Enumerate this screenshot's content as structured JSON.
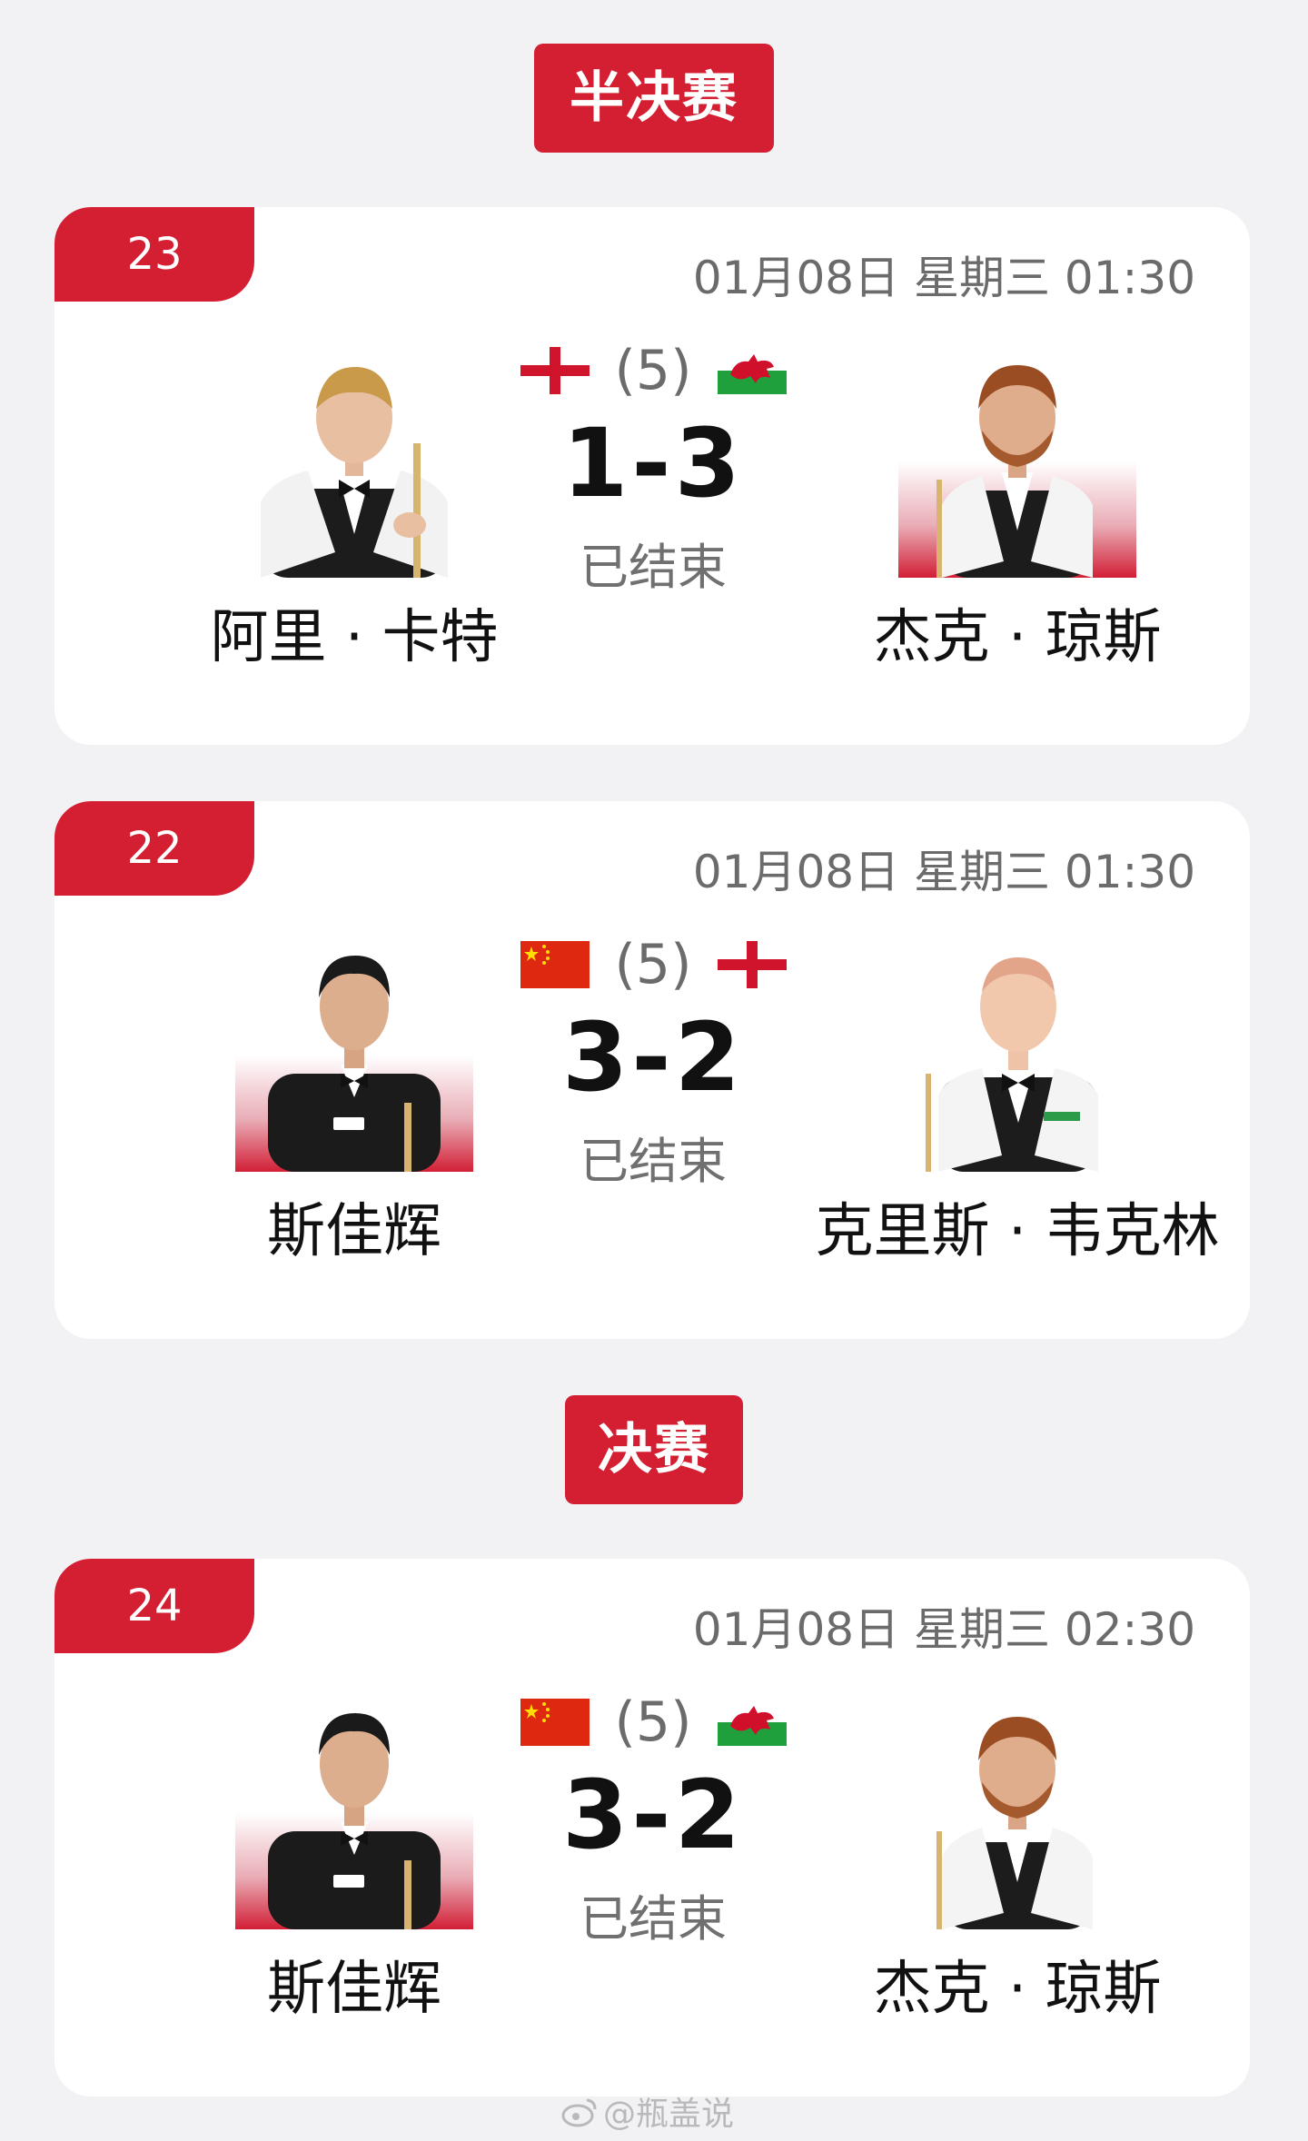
{
  "sections": [
    {
      "label": "半决赛"
    },
    {
      "label": "决赛"
    }
  ],
  "matches": [
    {
      "number": "23",
      "datetime": "01月08日 星期三 01:30",
      "frames": "(5)",
      "score": "1-3",
      "status": "已结束",
      "left": {
        "name": "阿里 · 卡特",
        "flag": "england-flag",
        "photo_bg": false
      },
      "right": {
        "name": "杰克 · 琼斯",
        "flag": "wales-flag",
        "photo_bg": true
      }
    },
    {
      "number": "22",
      "datetime": "01月08日 星期三 01:30",
      "frames": "(5)",
      "score": "3-2",
      "status": "已结束",
      "left": {
        "name": "斯佳辉",
        "flag": "china-flag",
        "photo_bg": true
      },
      "right": {
        "name": "克里斯 · 韦克林",
        "flag": "england-flag",
        "photo_bg": false
      }
    },
    {
      "number": "24",
      "datetime": "01月08日 星期三 02:30",
      "frames": "(5)",
      "score": "3-2",
      "status": "已结束",
      "left": {
        "name": "斯佳辉",
        "flag": "china-flag",
        "photo_bg": true
      },
      "right": {
        "name": "杰克 · 琼斯",
        "flag": "wales-flag",
        "photo_bg": false
      }
    }
  ],
  "watermark": "@瓶盖说",
  "colors": {
    "accent": "#d41f33",
    "background": "#f2f2f5",
    "card": "#ffffff",
    "muted_text": "#6b6b6b"
  }
}
